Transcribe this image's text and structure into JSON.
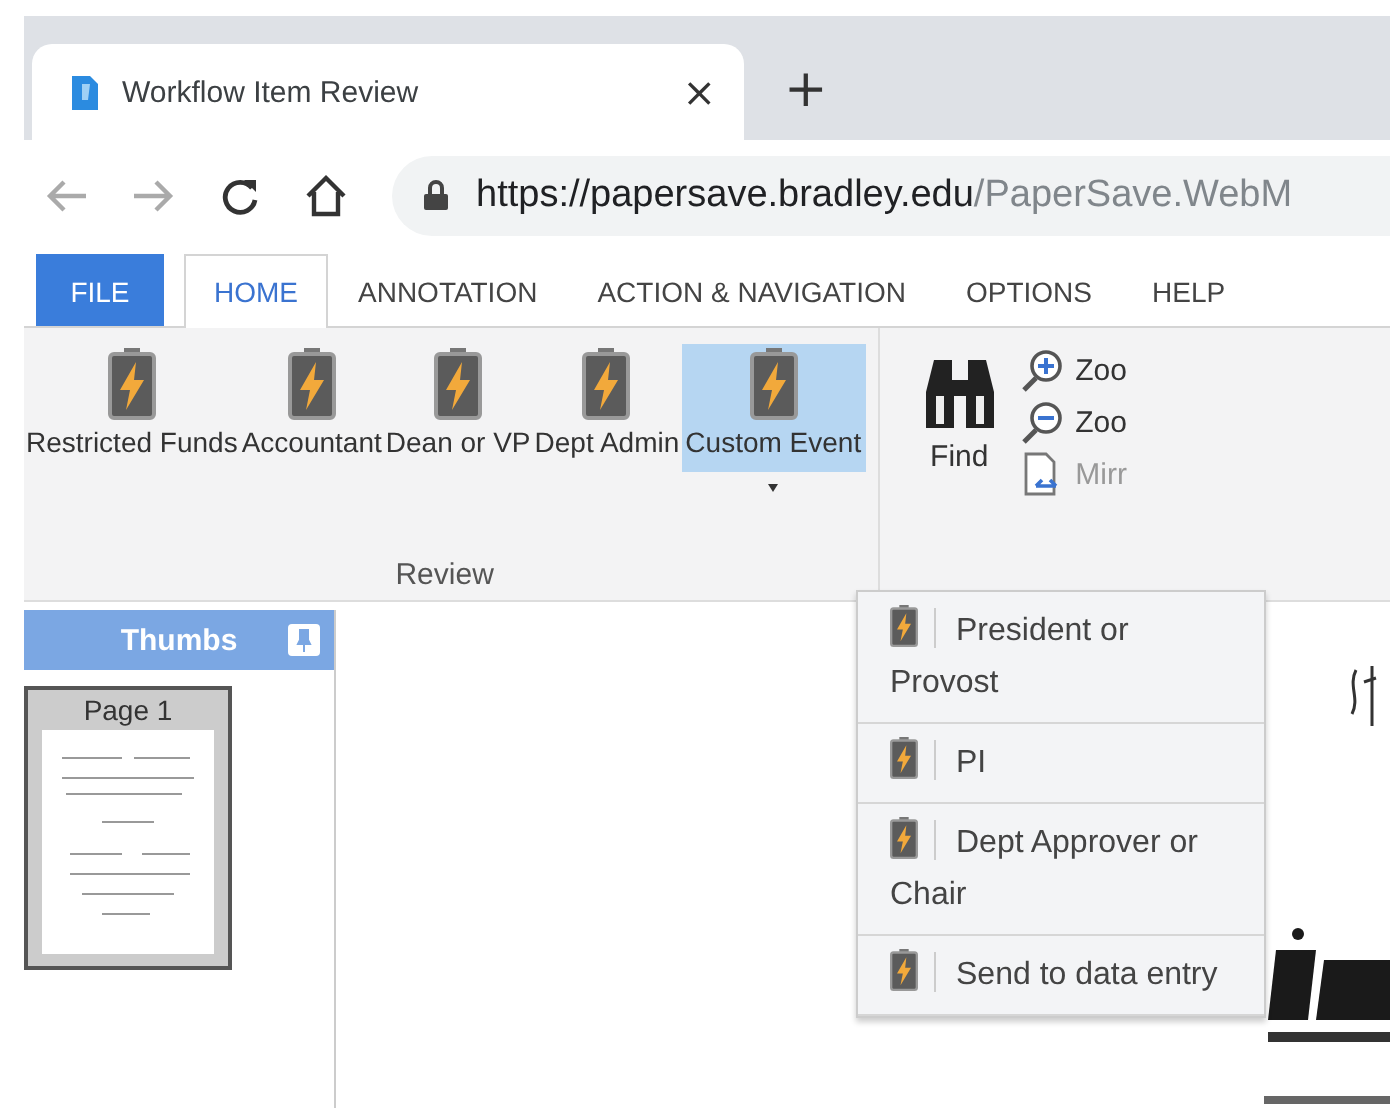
{
  "browser": {
    "tab": {
      "title": "Workflow Item Review",
      "close": "×"
    },
    "new_tab": "+",
    "url": {
      "host": "https://papersave.bradley.edu",
      "path": "/PaperSave.WebM"
    }
  },
  "ribbon": {
    "tabs": [
      {
        "label": "FILE",
        "kind": "file",
        "selected": false
      },
      {
        "label": "HOME",
        "kind": "tab",
        "selected": true
      },
      {
        "label": "ANNOTATION",
        "kind": "tab",
        "selected": false
      },
      {
        "label": "ACTION & NAVIGATION",
        "kind": "tab",
        "selected": false
      },
      {
        "label": "OPTIONS",
        "kind": "tab",
        "selected": false
      },
      {
        "label": "HELP",
        "kind": "tab",
        "selected": false
      }
    ],
    "review": {
      "label": "Review",
      "buttons": [
        {
          "label": "Restricted Funds",
          "selected": false,
          "dropdown": false
        },
        {
          "label": "Accountant",
          "selected": false,
          "dropdown": false
        },
        {
          "label": "Dean or VP",
          "selected": false,
          "dropdown": false
        },
        {
          "label": "Dept Admin",
          "selected": false,
          "dropdown": false
        },
        {
          "label": "Custom Event",
          "selected": true,
          "dropdown": true
        }
      ]
    },
    "find": {
      "label": "Find"
    },
    "view_items": [
      {
        "label": "Zoo",
        "kind": "zoom-in",
        "disabled": false
      },
      {
        "label": "Zoo",
        "kind": "zoom-out",
        "disabled": false
      },
      {
        "label": "Mirr",
        "kind": "mirror",
        "disabled": true
      }
    ]
  },
  "thumbs": {
    "title": "Thumbs",
    "pages": [
      {
        "label": "Page 1",
        "selected": true
      }
    ]
  },
  "menu": {
    "items": [
      {
        "label": "President or Provost"
      },
      {
        "label": "PI"
      },
      {
        "label": "Dept Approver or Chair"
      },
      {
        "label": "Send to data entry"
      }
    ]
  }
}
